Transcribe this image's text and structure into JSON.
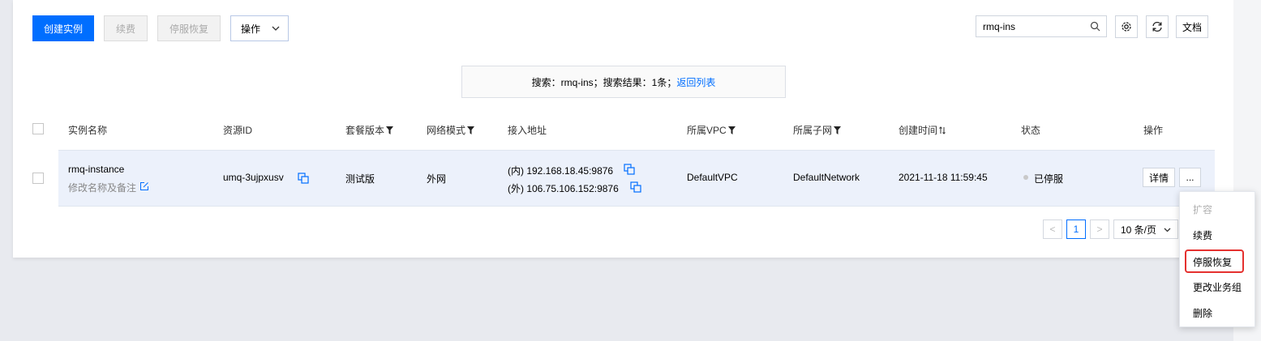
{
  "toolbar": {
    "create_label": "创建实例",
    "renew_label": "续费",
    "resume_label": "停服恢复",
    "ops_label": "操作"
  },
  "search": {
    "value": "rmq-ins"
  },
  "docs_label": "文档",
  "search_result": {
    "prefix": "搜索：rmq-ins；搜索结果：1条；",
    "back_link": "返回列表"
  },
  "table": {
    "headers": {
      "name": "实例名称",
      "resource_id": "资源ID",
      "package": "套餐版本",
      "network": "网络模式",
      "address": "接入地址",
      "vpc": "所属VPC",
      "subnet": "所属子网",
      "created": "创建时间",
      "status": "状态",
      "actions": "操作"
    },
    "rows": [
      {
        "name": "rmq-instance",
        "edit_note": "修改名称及备注",
        "resource_id": "umq-3ujpxusv",
        "package": "测试版",
        "network": "外网",
        "address_internal": "(内) 192.168.18.45:9876",
        "address_external": "(外) 106.75.106.152:9876",
        "vpc": "DefaultVPC",
        "subnet": "DefaultNetwork",
        "created": "2021-11-18 11:59:45",
        "status": "已停服",
        "detail_label": "详情",
        "more_label": "..."
      }
    ]
  },
  "pagination": {
    "prev": "<",
    "current": "1",
    "next": ">",
    "page_size": "10 条/页"
  },
  "dropdown_menu": {
    "items": [
      {
        "label": "扩容",
        "disabled": true
      },
      {
        "label": "续费",
        "disabled": false
      },
      {
        "label": "停服恢复",
        "disabled": false
      },
      {
        "label": "更改业务组",
        "disabled": false
      },
      {
        "label": "删除",
        "disabled": false
      }
    ]
  },
  "colors": {
    "primary": "#006eff",
    "highlight": "#e5312f",
    "row_bg": "#ecf1fb"
  }
}
